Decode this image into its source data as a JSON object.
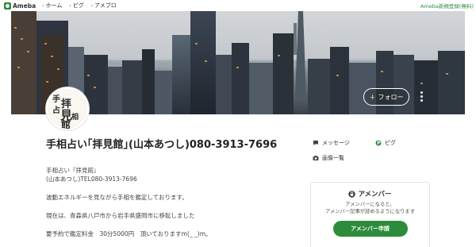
{
  "topbar": {
    "logo": "Ameba",
    "nav": [
      {
        "label": "ホーム"
      },
      {
        "label": "ピグ"
      },
      {
        "label": "アメブロ"
      }
    ],
    "signup": "Ameba新規登録(無料)"
  },
  "header": {
    "follow_label": "フォロー",
    "follow_icon": "plus-icon",
    "more_icon": "more-vertical-icon"
  },
  "avatar": {
    "chars": [
      "手",
      "相",
      "占",
      "拝",
      "見",
      "館"
    ]
  },
  "blog": {
    "title": "手相占い｢拝見館｣(山本あつし)080-3913-7696"
  },
  "side_links": [
    {
      "label": "メッセージ",
      "icon": "message-icon"
    },
    {
      "label": "ピグ",
      "icon": "pigg-icon"
    },
    {
      "label": "画像一覧",
      "icon": "camera-icon"
    }
  ],
  "profile": {
    "lines": [
      "手相占い『拝見館』",
      "(山本あつし)TEL080-3913-7696",
      "",
      "波動エネルギーを見ながら手相を鑑定しております。",
      "",
      "現在は、青森県八戸市から岩手県盛岡市に移転しました",
      "",
      "要予約で鑑定料金　30分5000円　頂いておりますm(_ _)m。"
    ]
  },
  "member": {
    "title": "アメンバー",
    "desc_line1": "アメンバーになると、",
    "desc_line2": "アメンバー記事が読めるようになります",
    "button": "アメンバー申請"
  },
  "colors": {
    "brand_green": "#2d8c3c"
  }
}
